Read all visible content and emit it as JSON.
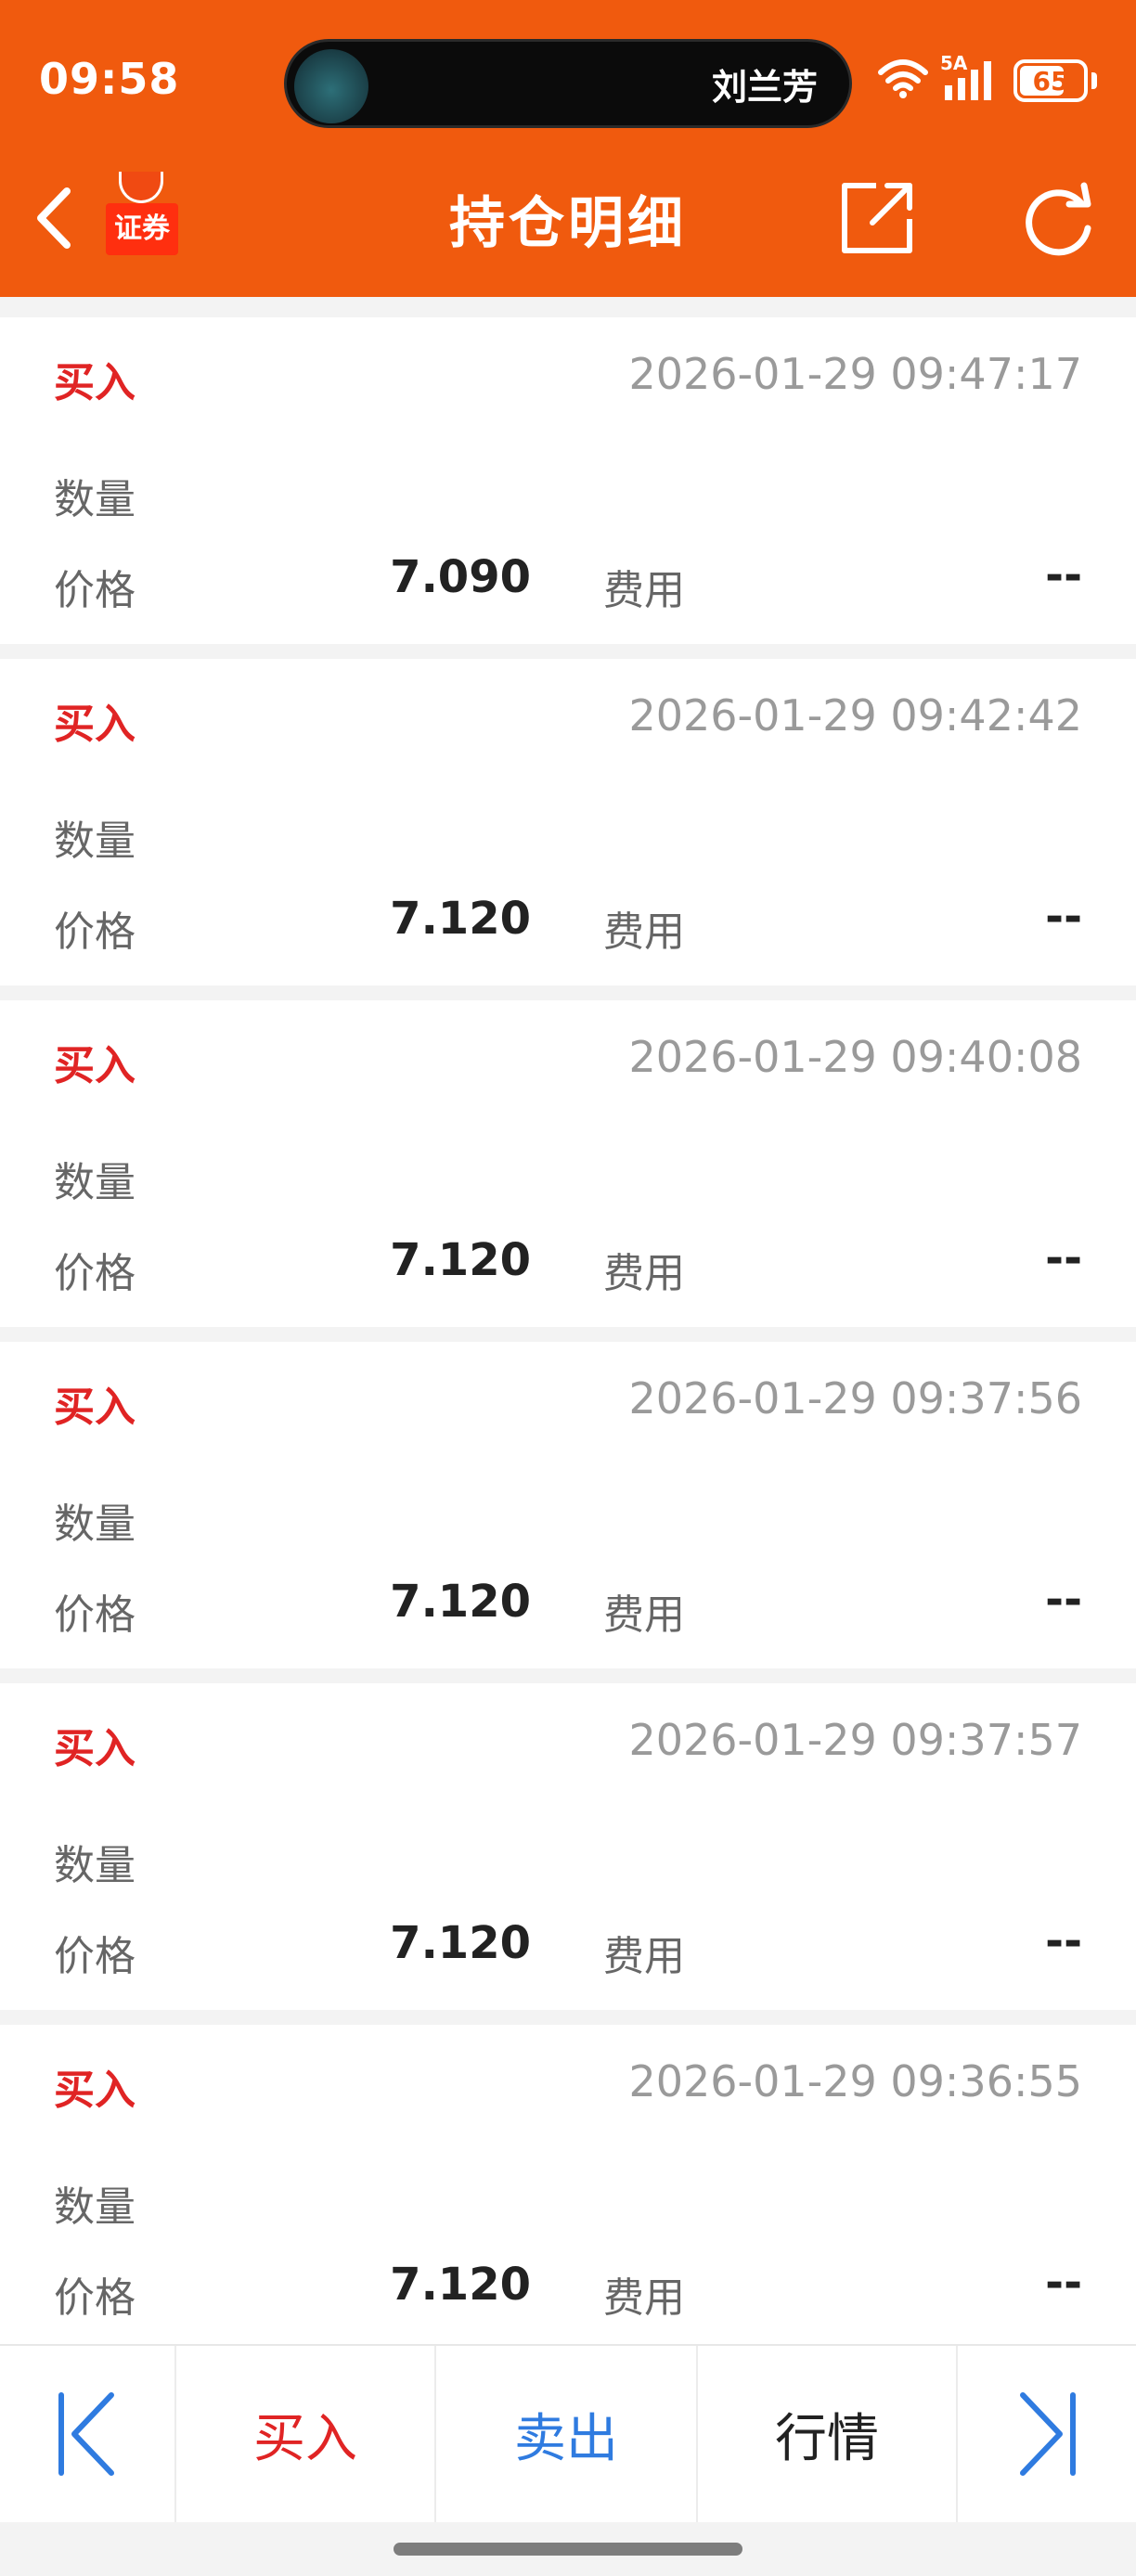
{
  "status_bar": {
    "time": "09:58",
    "island_name": "刘兰芳",
    "network": "5A",
    "battery": "65"
  },
  "header": {
    "title": "持仓明细",
    "logo_text": "证券",
    "background_color": "#f05a0e"
  },
  "labels": {
    "quantity": "数量",
    "price": "价格",
    "fee": "费用"
  },
  "trades": [
    {
      "type": "买入",
      "time": "2026-01-29 09:47:17",
      "price": "7.090",
      "fee": "--"
    },
    {
      "type": "买入",
      "time": "2026-01-29 09:42:42",
      "price": "7.120",
      "fee": "--"
    },
    {
      "type": "买入",
      "time": "2026-01-29 09:40:08",
      "price": "7.120",
      "fee": "--"
    },
    {
      "type": "买入",
      "time": "2026-01-29 09:37:56",
      "price": "7.120",
      "fee": "--"
    },
    {
      "type": "买入",
      "time": "2026-01-29 09:37:57",
      "price": "7.120",
      "fee": "--"
    },
    {
      "type": "买入",
      "time": "2026-01-29 09:36:55",
      "price": "7.120",
      "fee": "--"
    }
  ],
  "bottom_bar": {
    "buy": "买入",
    "sell": "卖出",
    "market": "行情",
    "buy_color": "#e02424",
    "sell_color": "#2f7be0",
    "icon_color": "#2f7be0"
  }
}
